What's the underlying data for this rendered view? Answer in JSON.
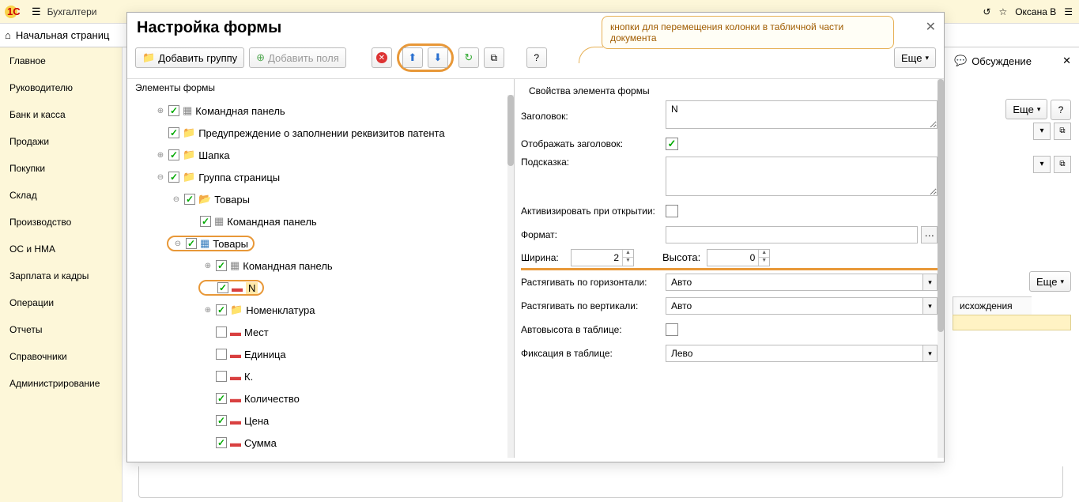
{
  "topbar": {
    "tab": "Бухгалтери",
    "user": "Оксана В"
  },
  "secondbar": {
    "home": "Начальная страниц"
  },
  "leftnav": {
    "items": [
      "Главное",
      "Руководителю",
      "Банк и касса",
      "Продажи",
      "Покупки",
      "Склад",
      "Производство",
      "ОС и НМА",
      "Зарплата и кадры",
      "Операции",
      "Отчеты",
      "Справочники",
      "Администрирование"
    ]
  },
  "rightpanel": {
    "title": "Обсуждение",
    "more": "Еще"
  },
  "bg": {
    "more": "Еще",
    "col": "исхождения"
  },
  "callout": "кнопки для перемещения колонки в табличной части документа",
  "modal": {
    "title": "Настройка формы",
    "add_group": "Добавить группу",
    "add_fields": "Добавить поля",
    "more": "Еще",
    "left_title": "Элементы формы",
    "right_title": "Свойства элемента формы",
    "tree": {
      "cmd_panel": "Командная панель",
      "warn_patent": "Предупреждение о заполнении реквизитов патента",
      "header": "Шапка",
      "page_group": "Группа страницы",
      "goods1": "Товары",
      "cmd_panel2": "Командная панель",
      "goods2": "Товары",
      "cmd_panel3": "Командная панель",
      "n": "N",
      "nomenclature": "Номенклатура",
      "places": "Мест",
      "unit": "Единица",
      "k": "К.",
      "qty": "Количество",
      "price": "Цена",
      "sum": "Сумма"
    },
    "props": {
      "title_lbl": "Заголовок:",
      "title_val": "N",
      "show_title_lbl": "Отображать заголовок:",
      "hint_lbl": "Подсказка:",
      "activate_lbl": "Активизировать при открытии:",
      "format_lbl": "Формат:",
      "width_lbl": "Ширина:",
      "width_val": "2",
      "height_lbl": "Высота:",
      "height_val": "0",
      "stretch_h_lbl": "Растягивать по горизонтали:",
      "stretch_h_val": "Авто",
      "stretch_v_lbl": "Растягивать по вертикали:",
      "stretch_v_val": "Авто",
      "autoheight_lbl": "Автовысота в таблице:",
      "fixation_lbl": "Фиксация в таблице:",
      "fixation_val": "Лево"
    }
  }
}
